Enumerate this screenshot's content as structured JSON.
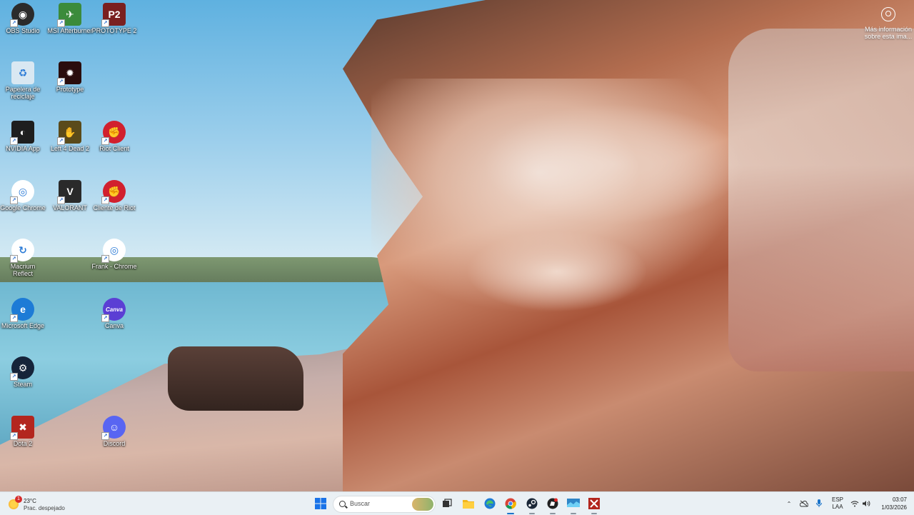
{
  "wallpaper_info": {
    "label": "Más información sobre esta ima..."
  },
  "desktop_icons": [
    {
      "label": "OBS Studio",
      "icon": "obs-icon",
      "color": "#2b2b2b",
      "glyph": "◉"
    },
    {
      "label": "MSI Afterburner",
      "icon": "msi-afterburner-icon",
      "color": "#3b8b3b",
      "glyph": "✈"
    },
    {
      "label": "PROTOTYPE 2",
      "icon": "prototype2-icon",
      "color": "#7a2020",
      "glyph": "P2"
    },
    {
      "label": "Papelera de reciclaje",
      "icon": "recycle-bin-icon",
      "color": "#d9e8f2",
      "glyph": "♻"
    },
    {
      "label": "Prototype",
      "icon": "prototype-icon",
      "color": "#2a0d0d",
      "glyph": "✹"
    },
    {
      "label": "NVIDIA App",
      "icon": "nvidia-icon",
      "color": "#1e1e1e",
      "glyph": "◐"
    },
    {
      "label": "Left 4 Dead 2",
      "icon": "left4dead2-icon",
      "color": "#5a4a1a",
      "glyph": "✋"
    },
    {
      "label": "Riot Client",
      "icon": "riot-client-icon",
      "color": "#d1202e",
      "glyph": "✊"
    },
    {
      "label": "Google Chrome",
      "icon": "chrome-icon",
      "color": "#ffffff",
      "glyph": "◎"
    },
    {
      "label": "VALORANT",
      "icon": "valorant-icon",
      "color": "#2a2a2a",
      "glyph": "V"
    },
    {
      "label": "Cliente de Riot",
      "icon": "riot-client-icon",
      "color": "#d1202e",
      "glyph": "✊"
    },
    {
      "label": "Macrium Reflect",
      "icon": "macrium-reflect-icon",
      "color": "#ffffff",
      "glyph": "↻"
    },
    {
      "label": "Frank - Chrome",
      "icon": "chrome-profile-icon",
      "color": "#ffffff",
      "glyph": "◎"
    },
    {
      "label": "Microsoft Edge",
      "icon": "edge-icon",
      "color": "#1d7bd6",
      "glyph": "e"
    },
    {
      "label": "Canva",
      "icon": "canva-icon",
      "color": "#5b3fd4",
      "glyph": "Canva"
    },
    {
      "label": "Steam",
      "icon": "steam-icon",
      "color": "#16243a",
      "glyph": "⚙"
    },
    {
      "label": "Dota 2",
      "icon": "dota2-icon",
      "color": "#b3261e",
      "glyph": "✖"
    },
    {
      "label": "Discord",
      "icon": "discord-icon",
      "color": "#5865f2",
      "glyph": "☺"
    }
  ],
  "taskbar": {
    "weather": {
      "temp": "23°C",
      "condition": "Prac. despejado",
      "badge": "1"
    },
    "search_placeholder": "Buscar",
    "apps": [
      {
        "name": "start-button",
        "icon": "windows-start-icon",
        "running": false
      },
      {
        "name": "task-view-button",
        "icon": "task-view-icon",
        "running": false
      },
      {
        "name": "file-explorer-button",
        "icon": "folder-icon",
        "running": false
      },
      {
        "name": "edge-taskbar-button",
        "icon": "edge-icon",
        "running": false
      },
      {
        "name": "chrome-taskbar-button",
        "icon": "chrome-icon",
        "running": true
      },
      {
        "name": "steam-taskbar-button",
        "icon": "steam-icon",
        "running": true
      },
      {
        "name": "riot-taskbar-button",
        "icon": "riot-icon",
        "running": true
      },
      {
        "name": "display-taskbar-button",
        "icon": "display-icon",
        "running": true
      },
      {
        "name": "dota-taskbar-button",
        "icon": "dota2-icon",
        "running": true
      }
    ],
    "language": {
      "line1": "ESP",
      "line2": "LAA"
    },
    "clock": {
      "time": "03:07",
      "date": "1/03/2026"
    }
  }
}
